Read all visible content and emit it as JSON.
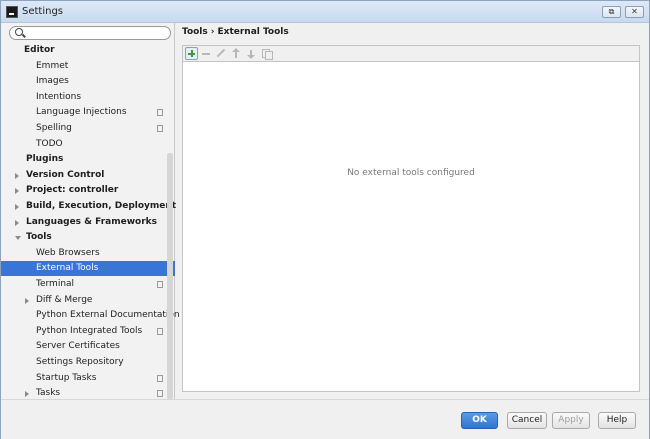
{
  "window": {
    "title": "Settings",
    "restore_glyph": "⧉",
    "close_glyph": "✕"
  },
  "search": {
    "placeholder": ""
  },
  "tree": {
    "items": [
      {
        "label": "Editor",
        "level": 0,
        "bold": true,
        "arrow": "none",
        "copy": false
      },
      {
        "label": "Emmet",
        "level": 1,
        "bold": false,
        "arrow": "none",
        "copy": false
      },
      {
        "label": "Images",
        "level": 1,
        "bold": false,
        "arrow": "none",
        "copy": false
      },
      {
        "label": "Intentions",
        "level": 1,
        "bold": false,
        "arrow": "none",
        "copy": false
      },
      {
        "label": "Language Injections",
        "level": 1,
        "bold": false,
        "arrow": "none",
        "copy": true
      },
      {
        "label": "Spelling",
        "level": 1,
        "bold": false,
        "arrow": "none",
        "copy": true
      },
      {
        "label": "TODO",
        "level": 1,
        "bold": false,
        "arrow": "none",
        "copy": false
      },
      {
        "label": "Plugins",
        "level": 0,
        "bold": true,
        "arrow": "none",
        "copy": false
      },
      {
        "label": "Version Control",
        "level": 0,
        "bold": true,
        "arrow": "right",
        "copy": false
      },
      {
        "label": "Project: controller",
        "level": 0,
        "bold": true,
        "arrow": "right",
        "copy": false
      },
      {
        "label": "Build, Execution, Deployment",
        "level": 0,
        "bold": true,
        "arrow": "right",
        "copy": false
      },
      {
        "label": "Languages & Frameworks",
        "level": 0,
        "bold": true,
        "arrow": "right",
        "copy": false
      },
      {
        "label": "Tools",
        "level": 0,
        "bold": true,
        "arrow": "down",
        "copy": false
      },
      {
        "label": "Web Browsers",
        "level": 1,
        "bold": false,
        "arrow": "none",
        "copy": false
      },
      {
        "label": "External Tools",
        "level": 1,
        "bold": false,
        "arrow": "none",
        "copy": false,
        "selected": true
      },
      {
        "label": "Terminal",
        "level": 1,
        "bold": false,
        "arrow": "none",
        "copy": true
      },
      {
        "label": "Diff & Merge",
        "level": 1,
        "bold": false,
        "arrow": "right",
        "copy": false
      },
      {
        "label": "Python External Documentation",
        "level": 1,
        "bold": false,
        "arrow": "none",
        "copy": false
      },
      {
        "label": "Python Integrated Tools",
        "level": 1,
        "bold": false,
        "arrow": "none",
        "copy": true
      },
      {
        "label": "Server Certificates",
        "level": 1,
        "bold": false,
        "arrow": "none",
        "copy": false
      },
      {
        "label": "Settings Repository",
        "level": 1,
        "bold": false,
        "arrow": "none",
        "copy": false
      },
      {
        "label": "Startup Tasks",
        "level": 1,
        "bold": false,
        "arrow": "none",
        "copy": true
      },
      {
        "label": "Tasks",
        "level": 1,
        "bold": false,
        "arrow": "right",
        "copy": true
      }
    ]
  },
  "breadcrumb": {
    "parent": "Tools",
    "separator": "›",
    "current": "External Tools"
  },
  "main": {
    "empty_text": "No external tools configured"
  },
  "buttons": {
    "ok": "OK",
    "cancel": "Cancel",
    "apply": "Apply",
    "help": "Help"
  },
  "colors": {
    "selection": "#3875d7",
    "ok_button": "#2f74d0",
    "add_icon": "#3a9a3a"
  }
}
